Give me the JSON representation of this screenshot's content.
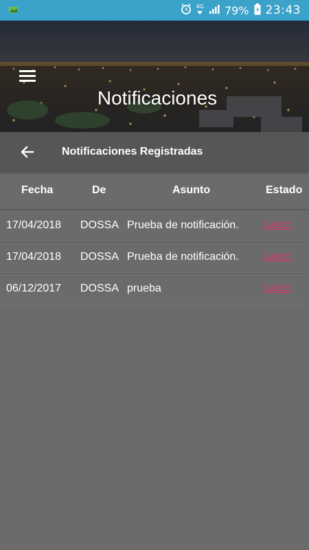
{
  "status_bar": {
    "network": "4G",
    "battery_percent": "79%",
    "time": "23:43"
  },
  "header": {
    "title": "Notificaciones"
  },
  "sub_bar": {
    "title": "Notificaciones Registradas"
  },
  "table": {
    "columns": [
      "Fecha",
      "De",
      "Asunto",
      "Estado"
    ],
    "rows": [
      {
        "fecha": "17/04/2018",
        "de": "DOSSA",
        "asunto": "Prueba de notificación.",
        "estado": "Leido"
      },
      {
        "fecha": "17/04/2018",
        "de": "DOSSA",
        "asunto": "Prueba de notificación.",
        "estado": "Leido"
      },
      {
        "fecha": "06/12/2017",
        "de": "DOSSA",
        "asunto": "prueba",
        "estado": "Leido"
      }
    ]
  },
  "colors": {
    "status_bar": "#3ba3c9",
    "background": "#6b6b6b",
    "sub_bar": "#565656",
    "link": "#e0336a"
  }
}
